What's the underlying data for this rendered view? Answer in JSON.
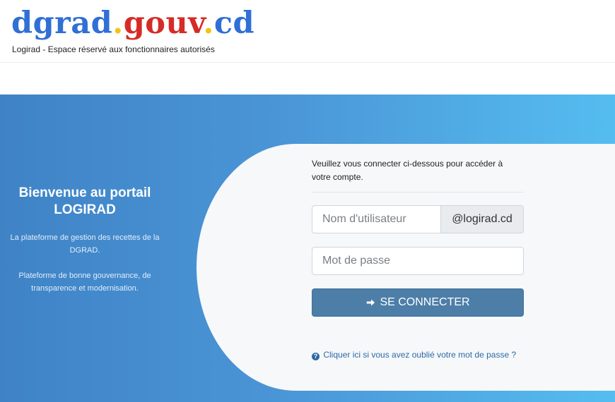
{
  "header": {
    "logo": {
      "part1": "dgrad",
      "dot1": ".",
      "part2": "gouv",
      "dot2": ".",
      "part3": "cd"
    },
    "tagline": "Logirad - Espace réservé aux fonctionnaires autorisés"
  },
  "welcome": {
    "title_line1": "Bienvenue au portail",
    "title_line2": "LOGIRAD",
    "text1": "La plateforme de gestion des recettes de la DGRAD.",
    "text2": "Plateforme de bonne gouvernance, de transparence et modernisation."
  },
  "login": {
    "intro": "Veuillez vous connecter ci-dessous pour accéder à votre compte.",
    "username": {
      "placeholder": "Nom d'utilisateur",
      "value": ""
    },
    "username_suffix": "@logirad.cd",
    "password": {
      "placeholder": "Mot de passe",
      "value": ""
    },
    "submit_label": "SE CONNECTER",
    "submit_icon": "arrow-right-icon",
    "forgot_label": "Cliquer ici si vous avez oublié votre mot de passe ?",
    "forgot_icon": "question-circle-icon"
  },
  "colors": {
    "logo_blue": "#2f6fd6",
    "logo_red": "#d62b26",
    "logo_dot": "#f0c419",
    "banner_start": "#3f83c6",
    "banner_end": "#55bdf0",
    "button": "#4d7ea8",
    "link": "#2d6aa6"
  }
}
